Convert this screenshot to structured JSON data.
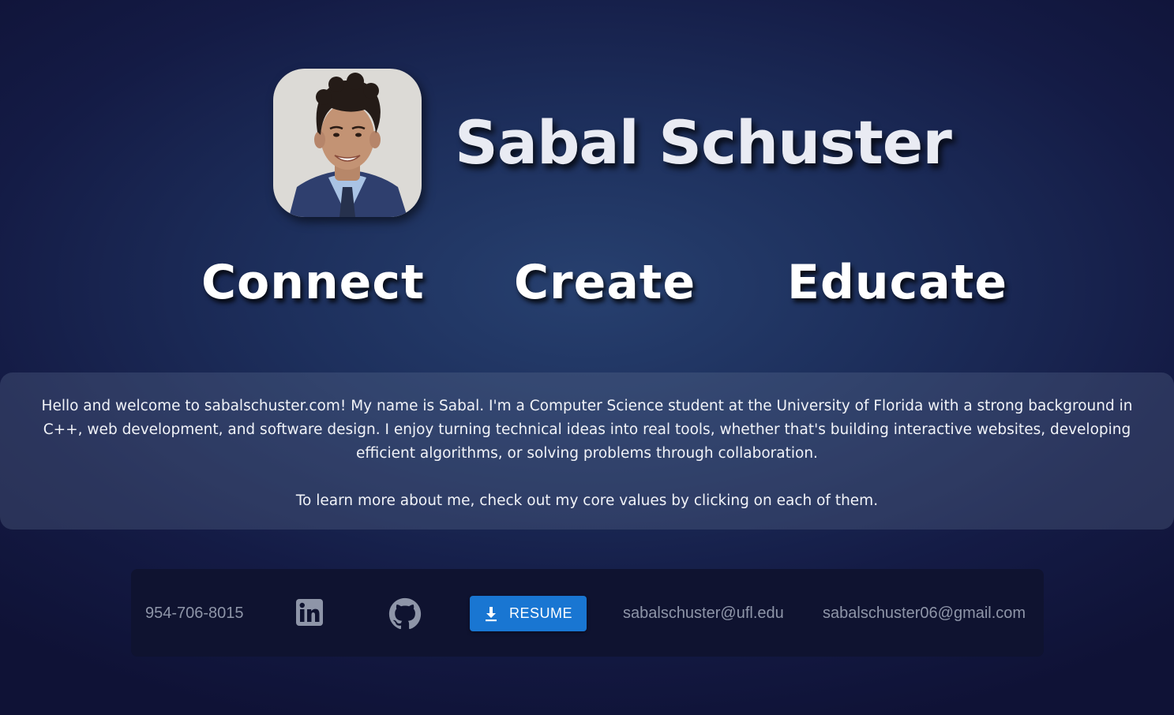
{
  "header": {
    "name": "Sabal Schuster",
    "avatar_alt": "Portrait photo of Sabal Schuster"
  },
  "values": [
    {
      "label": "Connect"
    },
    {
      "label": "Create"
    },
    {
      "label": "Educate"
    }
  ],
  "about": {
    "paragraph1": "Hello and welcome to sabalschuster.com! My name is Sabal. I'm a Computer Science student at the University of Florida with a strong background in C++, web development, and software design. I enjoy turning technical ideas into real tools, whether that's building interactive websites, developing efficient algorithms, or solving problems through collaboration.",
    "paragraph2": "To learn more about me, check out my core values by clicking on each of them."
  },
  "footer": {
    "phone": "954-706-8015",
    "linkedin_icon": "linkedin-icon",
    "github_icon": "github-icon",
    "resume_label": "RESUME",
    "resume_icon": "download-icon",
    "email_ufl": "sabalschuster@ufl.edu",
    "email_gmail": "sabalschuster06@gmail.com"
  },
  "colors": {
    "accent": "#1976d2",
    "background_center": "#27406f",
    "background_edge": "#0f1236",
    "footer_bg": "#0f1330",
    "muted_text": "#8e95a8"
  }
}
